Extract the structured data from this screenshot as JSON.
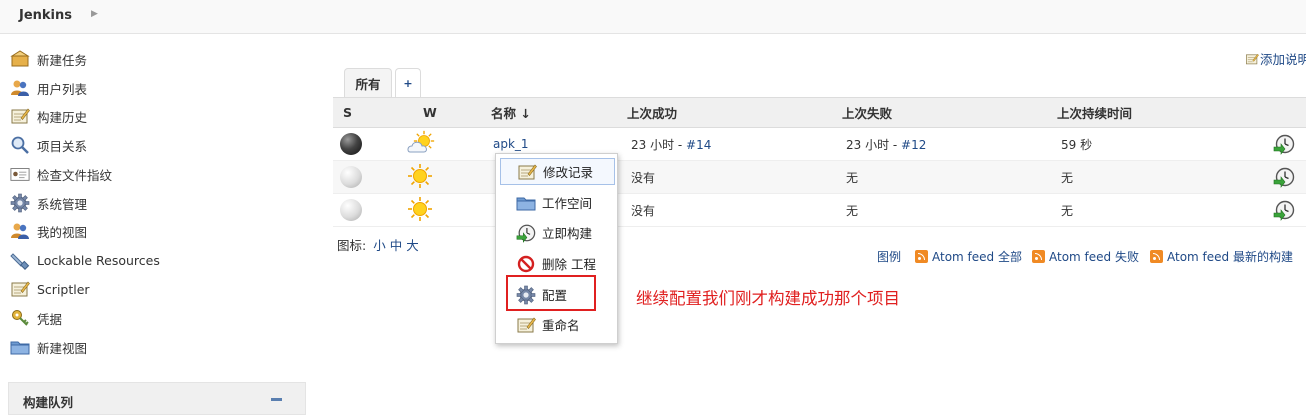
{
  "header": {
    "brand": "Jenkins"
  },
  "sidebar": {
    "items": [
      {
        "label": "新建任务",
        "icon": "new-item-icon"
      },
      {
        "label": "用户列表",
        "icon": "users-icon"
      },
      {
        "label": "构建历史",
        "icon": "notepad-icon"
      },
      {
        "label": "项目关系",
        "icon": "search-icon"
      },
      {
        "label": "检查文件指纹",
        "icon": "fingerprint-icon"
      },
      {
        "label": "系统管理",
        "icon": "gear-icon"
      },
      {
        "label": "我的视图",
        "icon": "users-icon"
      },
      {
        "label": "Lockable Resources",
        "icon": "plug-icon"
      },
      {
        "label": "Scriptler",
        "icon": "notepad-icon"
      },
      {
        "label": "凭据",
        "icon": "key-icon"
      },
      {
        "label": "新建视图",
        "icon": "folder-icon"
      }
    ],
    "build_queue_title": "构建队列"
  },
  "main": {
    "add_description": "添加说明",
    "tabs": [
      {
        "label": "所有"
      },
      {
        "label": "+"
      }
    ],
    "table": {
      "headers": [
        "S",
        "W",
        "名称 ↓",
        "上次成功",
        "上次失败",
        "上次持续时间"
      ],
      "rows": [
        {
          "name": "apk_1",
          "last_success_prefix": "23 小时 - ",
          "last_success_link": "#14",
          "last_failure_prefix": "23 小时 - ",
          "last_failure_link": "#12",
          "duration": "59 秒",
          "status": "dark",
          "weather": "partly-cloudy"
        },
        {
          "name": "",
          "last_success_prefix": "没有",
          "last_success_link": "",
          "last_failure_prefix": "无",
          "last_failure_link": "",
          "duration": "无",
          "status": "grey",
          "weather": "sunny"
        },
        {
          "name": "",
          "last_success_prefix": "没有",
          "last_success_link": "",
          "last_failure_prefix": "无",
          "last_failure_link": "",
          "duration": "无",
          "status": "grey",
          "weather": "sunny"
        }
      ]
    },
    "icon_legend": {
      "label": "图标:",
      "small": "小",
      "medium": "中",
      "large": "大"
    },
    "footer": {
      "legend": "图例",
      "feed_all": "Atom feed 全部",
      "feed_fail": "Atom feed 失败",
      "feed_latest": "Atom feed 最新的构建"
    }
  },
  "context_menu": {
    "items": [
      {
        "label": "修改记录",
        "icon": "notepad-icon"
      },
      {
        "label": "工作空间",
        "icon": "folder-icon"
      },
      {
        "label": "立即构建",
        "icon": "build-clock-icon"
      },
      {
        "label": "删除 工程",
        "icon": "no-entry-icon"
      },
      {
        "label": "配置",
        "icon": "gear-icon"
      },
      {
        "label": "重命名",
        "icon": "notepad-icon"
      }
    ]
  },
  "annotation": {
    "text": "继续配置我们刚才构建成功那个项目",
    "color": "#e02020"
  }
}
